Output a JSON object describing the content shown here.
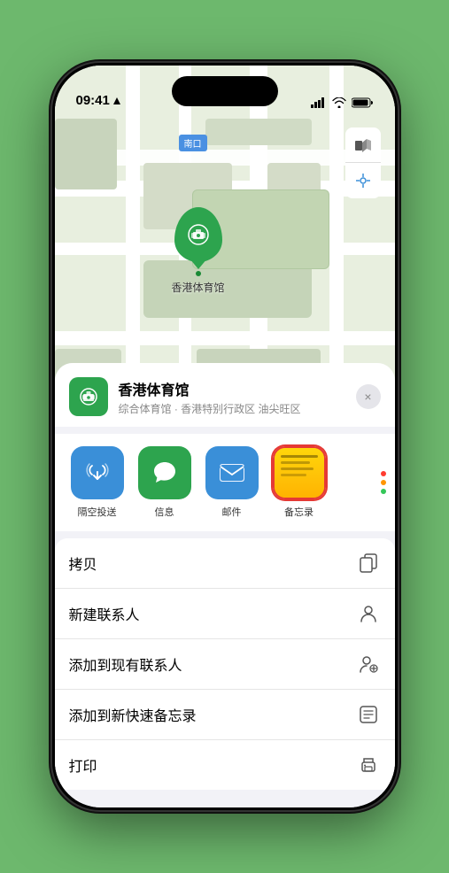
{
  "status": {
    "time": "09:41",
    "location_arrow": "▲"
  },
  "map": {
    "label": "南口",
    "venue_name": "香港体育馆",
    "controls": {
      "map_icon": "🗺",
      "location_icon": "◎"
    }
  },
  "sheet": {
    "venue_name": "香港体育馆",
    "venue_subtitle": "综合体育馆 · 香港特别行政区 油尖旺区",
    "close_label": "×"
  },
  "share_items": [
    {
      "label": "隔空投送",
      "type": "airdrop"
    },
    {
      "label": "信息",
      "type": "messages"
    },
    {
      "label": "邮件",
      "type": "mail"
    },
    {
      "label": "备忘录",
      "type": "notes"
    }
  ],
  "actions": [
    {
      "label": "拷贝",
      "icon": "copy"
    },
    {
      "label": "新建联系人",
      "icon": "person"
    },
    {
      "label": "添加到现有联系人",
      "icon": "person-add"
    },
    {
      "label": "添加到新快速备忘录",
      "icon": "note"
    },
    {
      "label": "打印",
      "icon": "print"
    }
  ]
}
